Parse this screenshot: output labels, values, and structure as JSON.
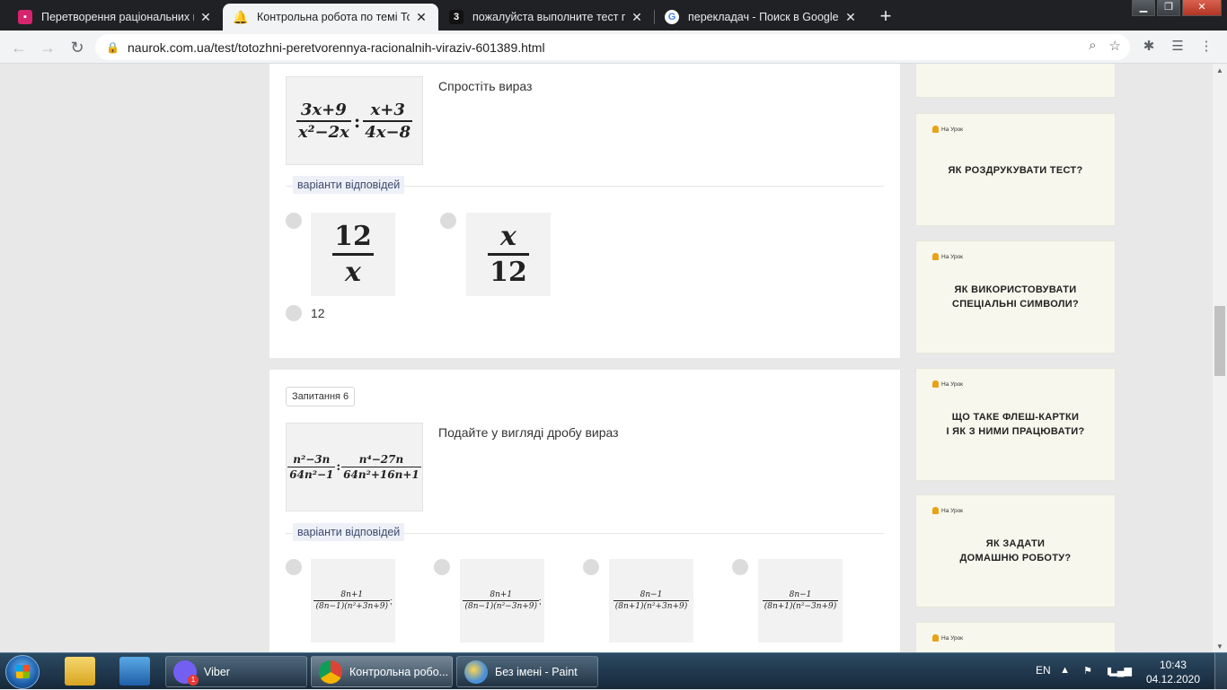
{
  "browser": {
    "tabs": [
      {
        "title": "Перетворення раціональних ви",
        "favicon_color": "#d6246e",
        "active": false
      },
      {
        "title": "Контрольна робота по темі Тот",
        "favicon_color": "#e8a317",
        "active": true
      },
      {
        "title": "пожалуйста выполните тест по",
        "favicon_glyph": "3",
        "active": false
      },
      {
        "title": "перекладач - Поиск в Google",
        "favicon_glyph": "G",
        "active": false
      }
    ],
    "new_tab": "+",
    "address": "naurok.com.ua/test/totozhni-peretvorennya-racionalnih-viraziv-601389.html"
  },
  "question5": {
    "prompt": "Спростіть вираз",
    "expr": {
      "left_num": "3x+9",
      "left_den": "x²−2x",
      "op": ":",
      "right_num": "x+3",
      "right_den": "4x−8"
    },
    "answers_label": "варіанти відповідей",
    "options": [
      {
        "num": "12",
        "den": "x"
      },
      {
        "num": "x",
        "den": "12"
      }
    ],
    "text_option": "12"
  },
  "question6": {
    "badge": "Запитання 6",
    "prompt": "Подайте у вигляді дробу вираз",
    "expr": {
      "left_num": "n²−3n",
      "left_den": "64n²−1",
      "op": ":",
      "right_num": "n⁴−27n",
      "right_den": "64n²+16n+1"
    },
    "answers_label": "варіанти відповідей",
    "options": [
      {
        "num": "8n+1",
        "den": "(8n−1)(n²+3n+9)",
        "suffix": ";"
      },
      {
        "num": "8n+1",
        "den": "(8n−1)(n²−3n+9)",
        "suffix": ";"
      },
      {
        "num": "8n−1",
        "den": "(8n+1)(n²+3n+9)",
        "suffix": ""
      },
      {
        "num": "8n−1",
        "den": "(8n+1)(n²−3n+9)",
        "suffix": ""
      }
    ]
  },
  "sidebar": {
    "brand": "На Урок",
    "cards": [
      {
        "text": "ЯК РОЗДРУКУВАТИ ТЕСТ?"
      },
      {
        "text": "ЯК ВИКОРИСТОВУВАТИ\nСПЕЦІАЛЬНІ СИМВОЛИ?"
      },
      {
        "text": "ЩО ТАКЕ ФЛЕШ-КАРТКИ\nІ ЯК З НИМИ ПРАЦЮВАТИ?"
      },
      {
        "text": "ЯК ЗАДАТИ\nДОМАШНЮ РОБОТУ?"
      }
    ]
  },
  "taskbar": {
    "buttons": [
      {
        "label": "Viber",
        "badge": "1",
        "color": "#7360f2"
      },
      {
        "label": "Контрольна робо...",
        "color": "#db4437"
      },
      {
        "label": "Без імені - Paint",
        "color": "#4a90d9"
      }
    ],
    "lang": "EN",
    "time": "10:43",
    "date": "04.12.2020"
  }
}
